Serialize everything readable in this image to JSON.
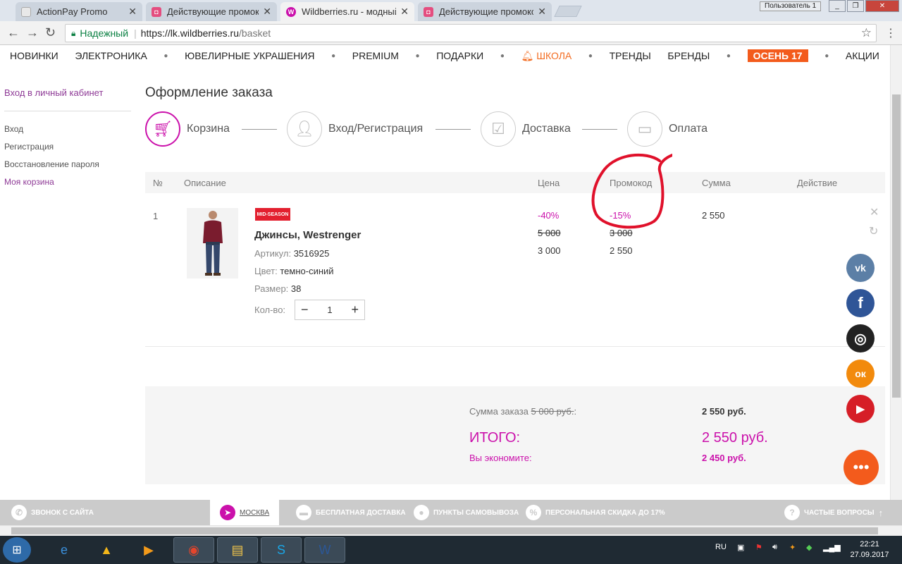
{
  "browser": {
    "tabs": [
      {
        "title": "ActionPay Promo",
        "favicon_color": "#e8e8e8"
      },
      {
        "title": "Действующие промокод",
        "favicon_color": "#e44d7f"
      },
      {
        "title": "Wildberries.ru - модный",
        "favicon_color": "#cb11ab",
        "active": true
      },
      {
        "title": "Действующие промокод",
        "favicon_color": "#e44d7f"
      }
    ],
    "tab_close": "✕",
    "user_badge": "Пользователь 1",
    "secure_label": "Надежный",
    "url_host": "https://lk.wildberries.ru",
    "url_path": "/basket"
  },
  "topnav": {
    "items": [
      "НОВИНКИ",
      "ЭЛЕКТРОНИКА",
      "ЮВЕЛИРНЫЕ УКРАШЕНИЯ",
      "PREMIUM",
      "ПОДАРКИ",
      "ШКОЛА",
      "ТРЕНДЫ",
      "БРЕНДЫ",
      "ОСЕНЬ 17",
      "АКЦИИ"
    ]
  },
  "sidebar": {
    "login": "Вход в личный кабинет",
    "links": [
      "Вход",
      "Регистрация",
      "Восстановление пароля",
      "Моя корзина"
    ]
  },
  "page": {
    "title": "Оформление заказа",
    "steps": [
      "Корзина",
      "Вход/Регистрация",
      "Доставка",
      "Оплата"
    ]
  },
  "table": {
    "headers": {
      "num": "№",
      "desc": "Описание",
      "price": "Цена",
      "promo": "Промокод",
      "sum": "Сумма",
      "action": "Действие"
    }
  },
  "item": {
    "num": "1",
    "badge": "MID-SEASON",
    "name": "Джинсы, Westrenger",
    "article_label": "Артикул:",
    "article": "3516925",
    "color_label": "Цвет:",
    "color": "темно-синий",
    "size_label": "Размер:",
    "size": "38",
    "qty_label": "Кол-во:",
    "qty": "1",
    "qty_minus": "−",
    "qty_plus": "+",
    "price_discount": "-40%",
    "price_old": "5 000",
    "price_new": "3 000",
    "promo_discount": "-15%",
    "promo_old": "3 000",
    "promo_new": "2 550",
    "sum": "2 550"
  },
  "summary": {
    "order_sum_label": "Сумма заказа",
    "order_sum_old": "5 000 руб.",
    "order_sum_colon": ":",
    "order_sum": "2 550 руб.",
    "total_label": "ИТОГО:",
    "total": "2 550 руб.",
    "save_label": "Вы экономите:",
    "save": "2 450 руб."
  },
  "social": [
    {
      "name": "vk",
      "color": "#5c7fa6",
      "glyph": "vk"
    },
    {
      "name": "facebook",
      "color": "#2f5597",
      "glyph": "f"
    },
    {
      "name": "instagram",
      "color": "#222222",
      "glyph": "◎"
    },
    {
      "name": "odnoklassniki",
      "color": "#f28a0c",
      "glyph": "ок"
    },
    {
      "name": "youtube",
      "color": "#d61e27",
      "glyph": "▶"
    }
  ],
  "bottombar": {
    "callback": "ЗВОНОК С САЙТА",
    "city": "МОСКВА",
    "delivery": "БЕСПЛАТНАЯ ДОСТАВКА",
    "pickup": "ПУНКТЫ САМОВЫВОЗА",
    "discount": "ПЕРСОНАЛЬНАЯ СКИДКА ДО 17%",
    "faq": "ЧАСТЫЕ ВОПРОСЫ"
  },
  "taskbar": {
    "lang": "RU",
    "time": "22:21",
    "date": "27.09.2017"
  },
  "colors": {
    "brand": "#cb11ab",
    "accent_orange": "#f35b1c"
  }
}
